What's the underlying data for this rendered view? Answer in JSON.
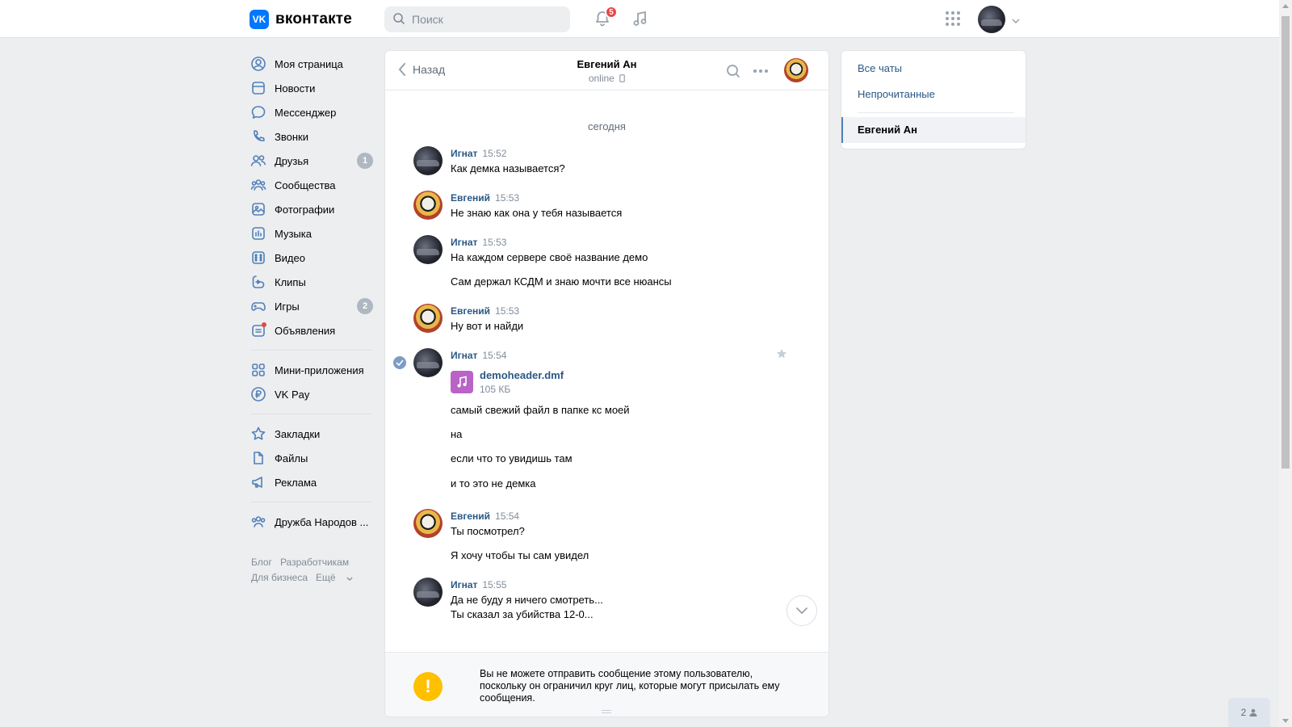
{
  "header": {
    "logo_text": "вконтакте",
    "logo_mark": "VK",
    "search_placeholder": "Поиск",
    "notifications_count": "5",
    "icons": [
      "search-icon",
      "bell-icon",
      "music-icon",
      "apps-grid-icon",
      "chevron-down-icon"
    ]
  },
  "nav": {
    "items": [
      {
        "label": "Моя страница",
        "icon": "user-circle-icon"
      },
      {
        "label": "Новости",
        "icon": "newspaper-icon"
      },
      {
        "label": "Мессенджер",
        "icon": "message-icon"
      },
      {
        "label": "Звонки",
        "icon": "phone-icon"
      },
      {
        "label": "Друзья",
        "icon": "friends-icon",
        "badge": "1"
      },
      {
        "label": "Сообщества",
        "icon": "communities-icon"
      },
      {
        "label": "Фотографии",
        "icon": "photo-icon"
      },
      {
        "label": "Музыка",
        "icon": "music-icon"
      },
      {
        "label": "Видео",
        "icon": "video-icon"
      },
      {
        "label": "Клипы",
        "icon": "clips-icon"
      },
      {
        "label": "Игры",
        "icon": "gamepad-icon",
        "badge": "2"
      },
      {
        "label": "Объявления",
        "icon": "classifieds-icon"
      }
    ],
    "items2": [
      {
        "label": "Мини-приложения",
        "icon": "mini-apps-icon"
      },
      {
        "label": "VK Pay",
        "icon": "vkpay-icon"
      }
    ],
    "items3": [
      {
        "label": "Закладки",
        "icon": "star-icon"
      },
      {
        "label": "Файлы",
        "icon": "file-icon"
      },
      {
        "label": "Реклама",
        "icon": "megaphone-icon"
      }
    ],
    "items4": [
      {
        "label": "Дружба Народов ...",
        "icon": "group-icon"
      }
    ],
    "footer": {
      "blog": "Блог",
      "developers": "Разработчикам",
      "business": "Для бизнеса",
      "more": "Ещё"
    }
  },
  "chat": {
    "back_label": "Назад",
    "peer_name": "Евгений Ан",
    "peer_status": "online",
    "date_separator": "сегодня",
    "messages": [
      {
        "author": "Игнат",
        "time": "15:52",
        "lines": [
          "Как демка называется?"
        ]
      },
      {
        "author": "Евгений",
        "time": "15:53",
        "lines": [
          "Не знаю как она у тебя называется"
        ]
      },
      {
        "author": "Игнат",
        "time": "15:53",
        "lines": [
          "На каждом сервере своё название демо",
          "Сам держал КСДМ и знаю мочти все нюансы"
        ]
      },
      {
        "author": "Евгений",
        "time": "15:53",
        "lines": [
          "Ну вот и найди"
        ]
      },
      {
        "author": "Игнат",
        "time": "15:54",
        "file": {
          "name": "demoheader.dmf",
          "size": "105 КБ"
        },
        "lines": [
          "самый свежий файл в папке кс моей",
          "на",
          "если что то увидишь там",
          "и то это не демка"
        ]
      },
      {
        "author": "Евгений",
        "time": "15:54",
        "lines": [
          "Ты посмотрел?",
          "Я хочу чтобы ты сам увидел"
        ]
      },
      {
        "author": "Игнат",
        "time": "15:55",
        "lines": [
          "Да не буду я ничего смотреть...",
          "Ты сказал за убийства 12-0..."
        ]
      }
    ],
    "notice": "Вы не можете отправить сообщение этому пользователю, поскольку он ограничил круг лиц, которые могут присылать ему сообщения."
  },
  "right_panel": {
    "all_chats": "Все чаты",
    "unread": "Непрочитанные",
    "active_chat": "Евгений Ан"
  },
  "online_widget": {
    "count": "2"
  },
  "colors": {
    "accent": "#0077ff",
    "link": "#2a5885",
    "badge_red": "#e64646",
    "warning": "#ffc000",
    "file": "#b963c7"
  }
}
